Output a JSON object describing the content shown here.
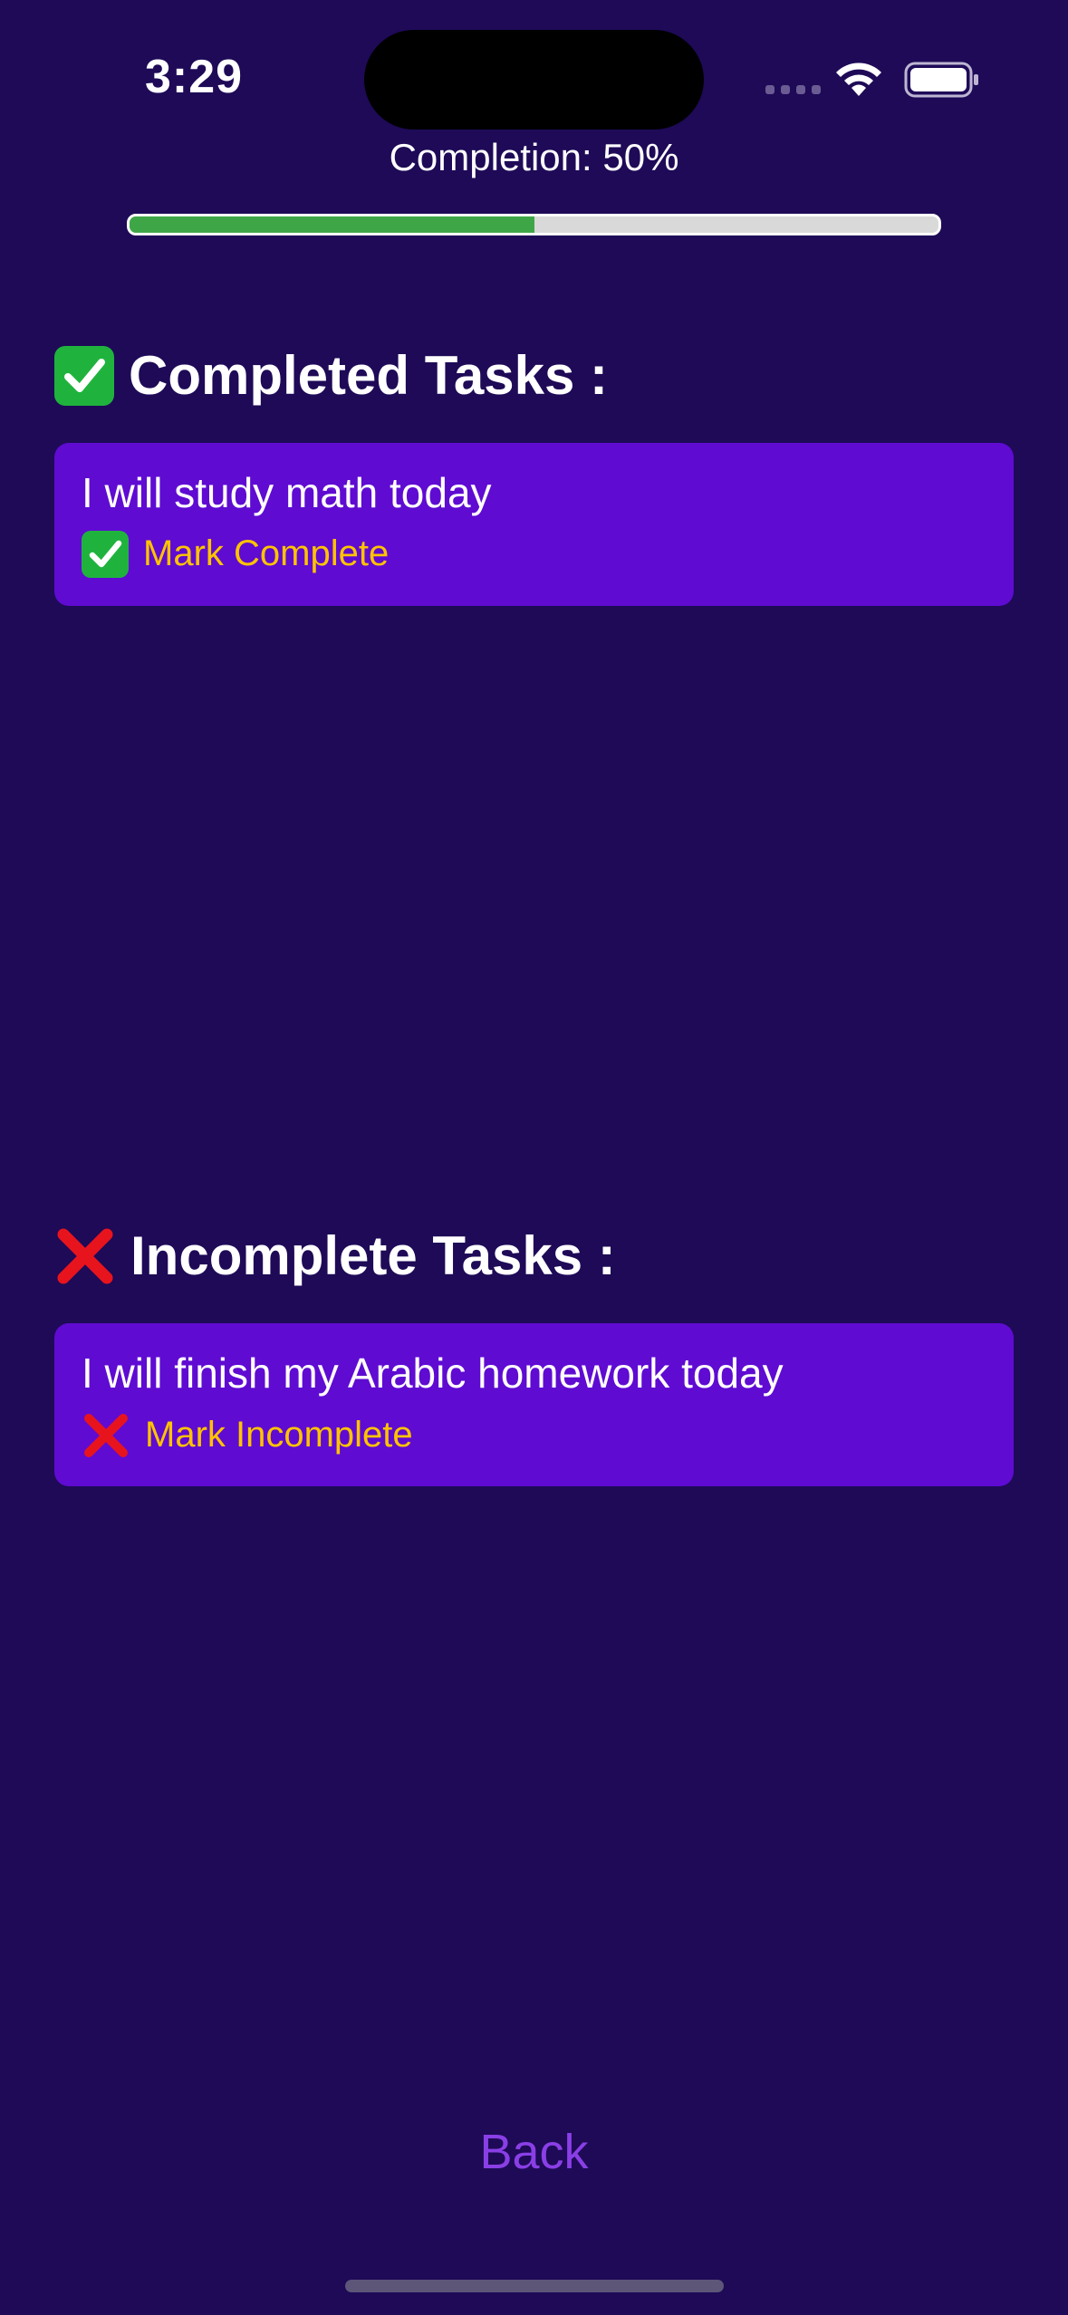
{
  "status_bar": {
    "time": "3:29",
    "wifi_icon": "wifi-icon",
    "battery_icon": "battery-icon"
  },
  "progress": {
    "label": "Completion: 50%",
    "value_fraction": 0.5,
    "fill_color": "#3fa648",
    "track_color": "#d9d9d9"
  },
  "completed_section": {
    "icon": "check-mark-box-icon",
    "title": "Completed Tasks :",
    "tasks": [
      {
        "text": "I will study math today",
        "action_icon": "check-mark-box-icon",
        "action_label": "Mark Complete"
      }
    ]
  },
  "incomplete_section": {
    "icon": "cross-mark-icon",
    "title": "Incomplete Tasks :",
    "tasks": [
      {
        "text": "I will finish my Arabic homework today",
        "action_icon": "cross-mark-icon",
        "action_label": "Mark Incomplete"
      }
    ]
  },
  "back_label": "Back",
  "colors": {
    "background": "#1e0a57",
    "card": "#5f0bd2",
    "action_text": "#ffc300",
    "back_text": "#8a3fe6"
  }
}
